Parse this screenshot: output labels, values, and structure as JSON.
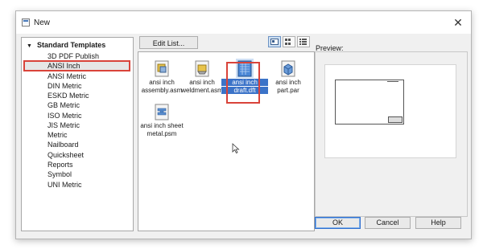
{
  "window": {
    "title": "New",
    "close_glyph": "✕"
  },
  "tree": {
    "root_label": "Standard Templates",
    "items": [
      {
        "label": "3D PDF Publish"
      },
      {
        "label": "ANSI Inch",
        "selected": true
      },
      {
        "label": "ANSI Metric"
      },
      {
        "label": "DIN Metric"
      },
      {
        "label": "ESKD Metric"
      },
      {
        "label": "GB Metric"
      },
      {
        "label": "ISO Metric"
      },
      {
        "label": "JIS Metric"
      },
      {
        "label": "Metric"
      },
      {
        "label": "Nailboard"
      },
      {
        "label": "Quicksheet"
      },
      {
        "label": "Reports"
      },
      {
        "label": "Symbol"
      },
      {
        "label": "UNI Metric"
      }
    ]
  },
  "toolbar": {
    "edit_list_label": "Edit List...",
    "view_modes": [
      "large-icons",
      "small-icons",
      "list"
    ]
  },
  "files": [
    {
      "line1": "ansi inch",
      "line2": "assembly.asm",
      "icon": "assembly-icon"
    },
    {
      "line1": "ansi inch",
      "line2": "weldment.asm",
      "icon": "weldment-icon"
    },
    {
      "line1": "ansi inch",
      "line2": "draft.dft",
      "icon": "draft-icon",
      "selected": true
    },
    {
      "line1": "ansi inch",
      "line2": "part.par",
      "icon": "part-icon"
    },
    {
      "line1": "ansi inch sheet",
      "line2": "metal.psm",
      "icon": "sheet-metal-icon"
    }
  ],
  "preview": {
    "label": "Preview:"
  },
  "buttons": {
    "ok": "OK",
    "cancel": "Cancel",
    "help": "Help"
  },
  "colors": {
    "highlight_box": "#d9433a",
    "selection": "#3b73c8"
  }
}
